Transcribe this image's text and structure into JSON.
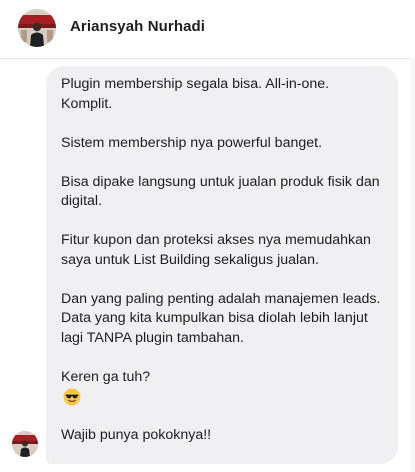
{
  "header": {
    "contact_name": "Ariansyah Nurhadi",
    "avatar_icon": "user-photo-avatar"
  },
  "message": {
    "paragraphs": [
      "Plugin membership segala bisa. All-in-one. Komplit.",
      "Sistem membership nya powerful banget.",
      "Bisa dipake langsung untuk jualan produk fisik dan digital.",
      "Fitur kupon dan proteksi akses nya memudahkan saya untuk List Building sekaligus jualan.",
      "Dan yang paling penting adalah manajemen leads. Data yang kita kumpulkan bisa diolah lebih lanjut lagi TANPA plugin tambahan.",
      "Keren ga tuh?"
    ],
    "emoji": "sunglasses-face-emoji",
    "last_line": "Wajib punya pokoknya!!"
  },
  "colors": {
    "bubble_bg": "#f0f0f2",
    "text": "#1c1e21",
    "emoji_yellow": "#f7c843"
  }
}
